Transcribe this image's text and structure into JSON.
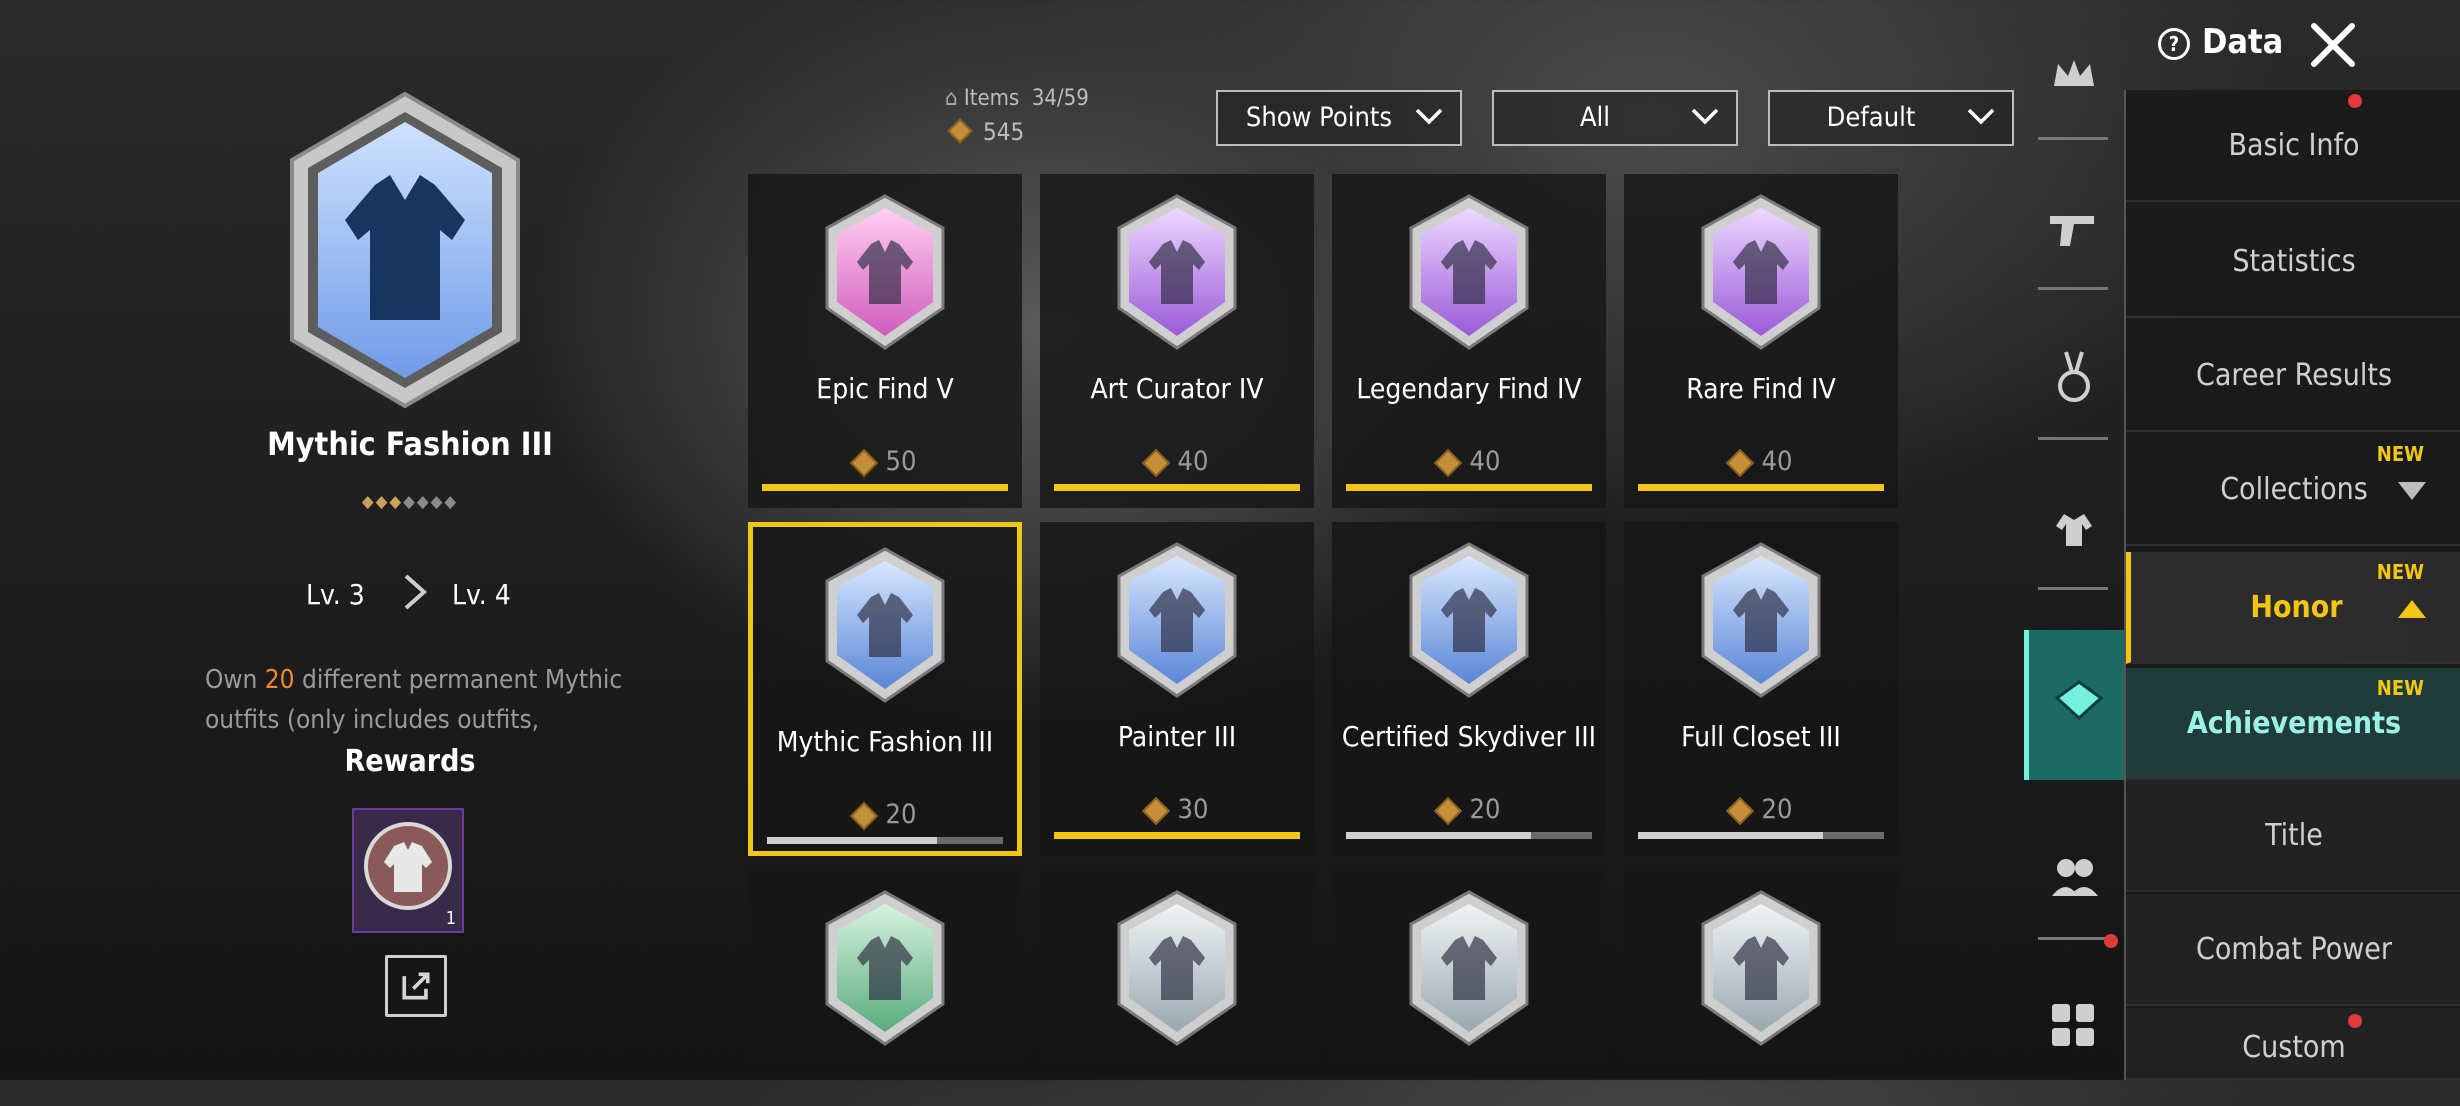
{
  "top": {
    "data_label": "Data",
    "help_icon": "question-circle-icon",
    "close_icon": "close-x-icon"
  },
  "detail": {
    "title": "Mythic Fashion III",
    "stars_filled": 3,
    "stars_total": 7,
    "level_from": "Lv. 3",
    "level_to": "Lv. 4",
    "desc_prefix": "Own ",
    "desc_count": "20",
    "desc_suffix": " different permanent Mythic outfits (only includes outfits,",
    "rewards_label": "Rewards",
    "reward_count": "1"
  },
  "stats": {
    "items_label": "Items",
    "items_value": "34/59",
    "points": "545"
  },
  "filters": [
    {
      "label": "Show Points"
    },
    {
      "label": "All"
    },
    {
      "label": "Default"
    }
  ],
  "cards": [
    {
      "name": "Epic Find V",
      "points": "50",
      "progress": 1.0,
      "bar": "#f2c614",
      "tone": "pink"
    },
    {
      "name": "Art Curator IV",
      "points": "40",
      "progress": 1.0,
      "bar": "#f2c614",
      "tone": "purple"
    },
    {
      "name": "Legendary Find IV",
      "points": "40",
      "progress": 1.0,
      "bar": "#f2c614",
      "tone": "purple"
    },
    {
      "name": "Rare Find IV",
      "points": "40",
      "progress": 1.0,
      "bar": "#f2c614",
      "tone": "purple"
    },
    {
      "name": "Mythic Fashion III",
      "points": "20",
      "progress": 0.72,
      "bar": "#cfcfcf",
      "tone": "blue",
      "selected": true
    },
    {
      "name": "Painter III",
      "points": "30",
      "progress": 1.0,
      "bar": "#f2c614",
      "tone": "blue"
    },
    {
      "name": "Certified Skydiver III",
      "points": "20",
      "progress": 0.75,
      "bar": "#cfcfcf",
      "tone": "blue"
    },
    {
      "name": "Full Closet III",
      "points": "20",
      "progress": 0.75,
      "bar": "#cfcfcf",
      "tone": "blue"
    },
    {
      "name": "",
      "points": "",
      "progress": null,
      "tone": "green"
    },
    {
      "name": "",
      "points": "",
      "progress": null,
      "tone": "silver"
    },
    {
      "name": "",
      "points": "",
      "progress": null,
      "tone": "silver"
    },
    {
      "name": "",
      "points": "",
      "progress": null,
      "tone": "silver"
    }
  ],
  "rail_icons": [
    "crown-icon",
    "pistol-icon",
    "medal-icon",
    "muscle-icon",
    "honor-badge-icon",
    "friends-icon",
    "grid-icon"
  ],
  "menu": [
    {
      "label": "Basic Info"
    },
    {
      "label": "Statistics"
    },
    {
      "label": "Career Results"
    },
    {
      "label": "Collections",
      "new": "NEW"
    },
    {
      "label": "Honor",
      "new": "NEW"
    },
    {
      "label": "Achievements",
      "new": "NEW"
    },
    {
      "label": "Title"
    },
    {
      "label": "Combat Power"
    },
    {
      "label": "Custom"
    }
  ],
  "colors": {
    "accent_yellow": "#f2c614",
    "teal_active": "#1d6a62",
    "highlight_orange": "#f08a2a"
  }
}
